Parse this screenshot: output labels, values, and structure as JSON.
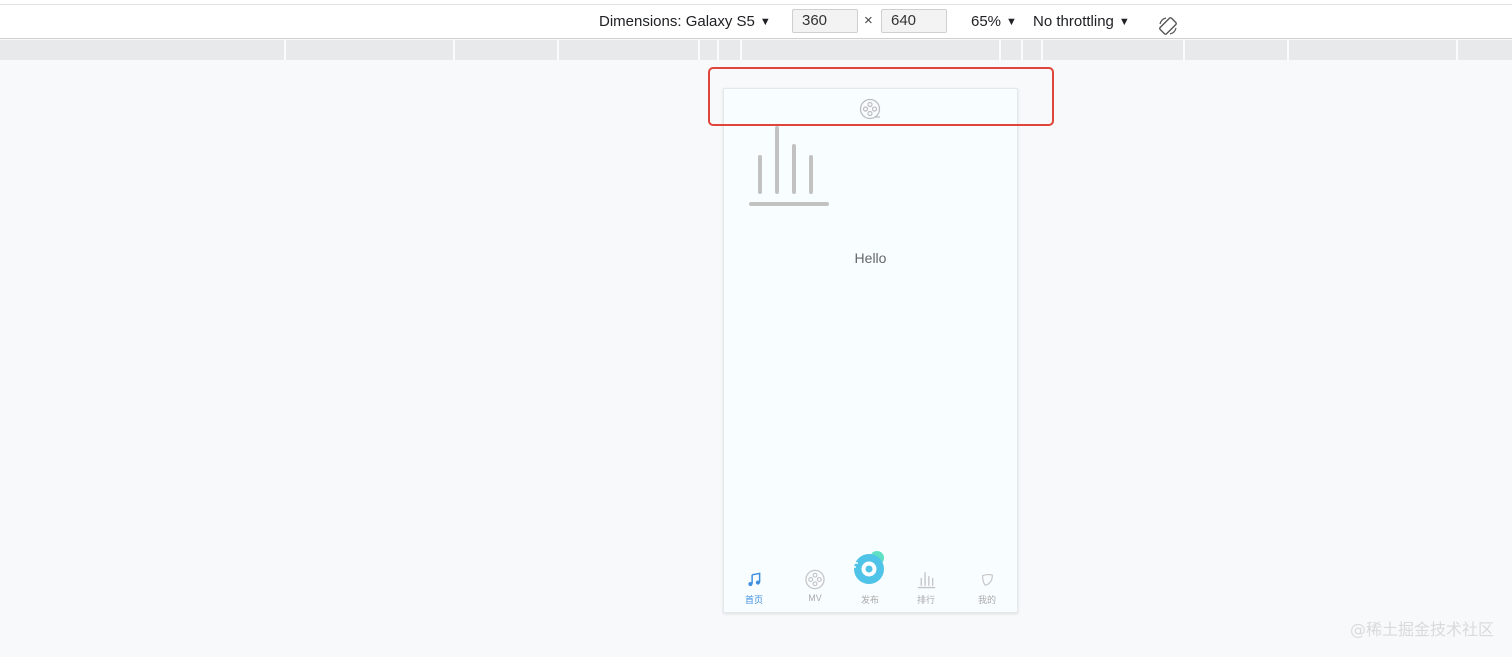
{
  "toolbar": {
    "device_label": "Dimensions: Galaxy S5",
    "width_value": "360",
    "height_value": "640",
    "times_symbol": "×",
    "zoom_label": "65%",
    "throttling_label": "No throttling",
    "caret": "▼",
    "rotate_icon": "rotate-icon"
  },
  "page": {
    "header_icon": "film-reel-icon",
    "equalizer_icon": "equalizer-icon",
    "greeting": "Hello"
  },
  "tabbar": {
    "tabs": [
      {
        "label": "首页",
        "icon": "music-note-icon",
        "active": true
      },
      {
        "label": "MV",
        "icon": "film-reel-icon",
        "active": false
      },
      {
        "label": "发布",
        "icon": "publish-disc-icon",
        "active": false
      },
      {
        "label": "排行",
        "icon": "chart-bars-icon",
        "active": false
      },
      {
        "label": "我的",
        "icon": "leaf-icon",
        "active": false
      }
    ]
  },
  "colors": {
    "accent": "#3f8fe0",
    "publish_accent": "#4fc3e8",
    "highlight_border": "#e0443a"
  },
  "watermark": "@稀土掘金技术社区"
}
